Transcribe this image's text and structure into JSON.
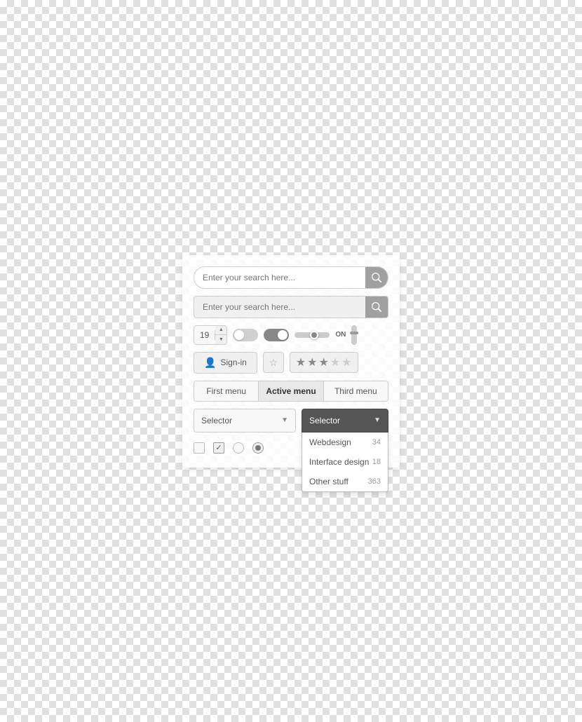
{
  "search1": {
    "placeholder": "Enter your search here...",
    "button_label": "search"
  },
  "search2": {
    "placeholder": "Enter your search here...",
    "button_label": "search"
  },
  "number_input": {
    "value": "19"
  },
  "signin": {
    "label": "Sign-in"
  },
  "menu": {
    "items": [
      {
        "label": "First menu",
        "active": false
      },
      {
        "label": "Active menu",
        "active": true
      },
      {
        "label": "Third menu",
        "active": false
      }
    ]
  },
  "selector_plain": {
    "label": "Selector"
  },
  "selector_active": {
    "label": "Selector",
    "dropdown": [
      {
        "label": "Webdesign",
        "count": "34"
      },
      {
        "label": "Interface design",
        "count": "18"
      },
      {
        "label": "Other stuff",
        "count": "363"
      }
    ]
  },
  "stars": {
    "filled": 3,
    "empty": 2
  }
}
